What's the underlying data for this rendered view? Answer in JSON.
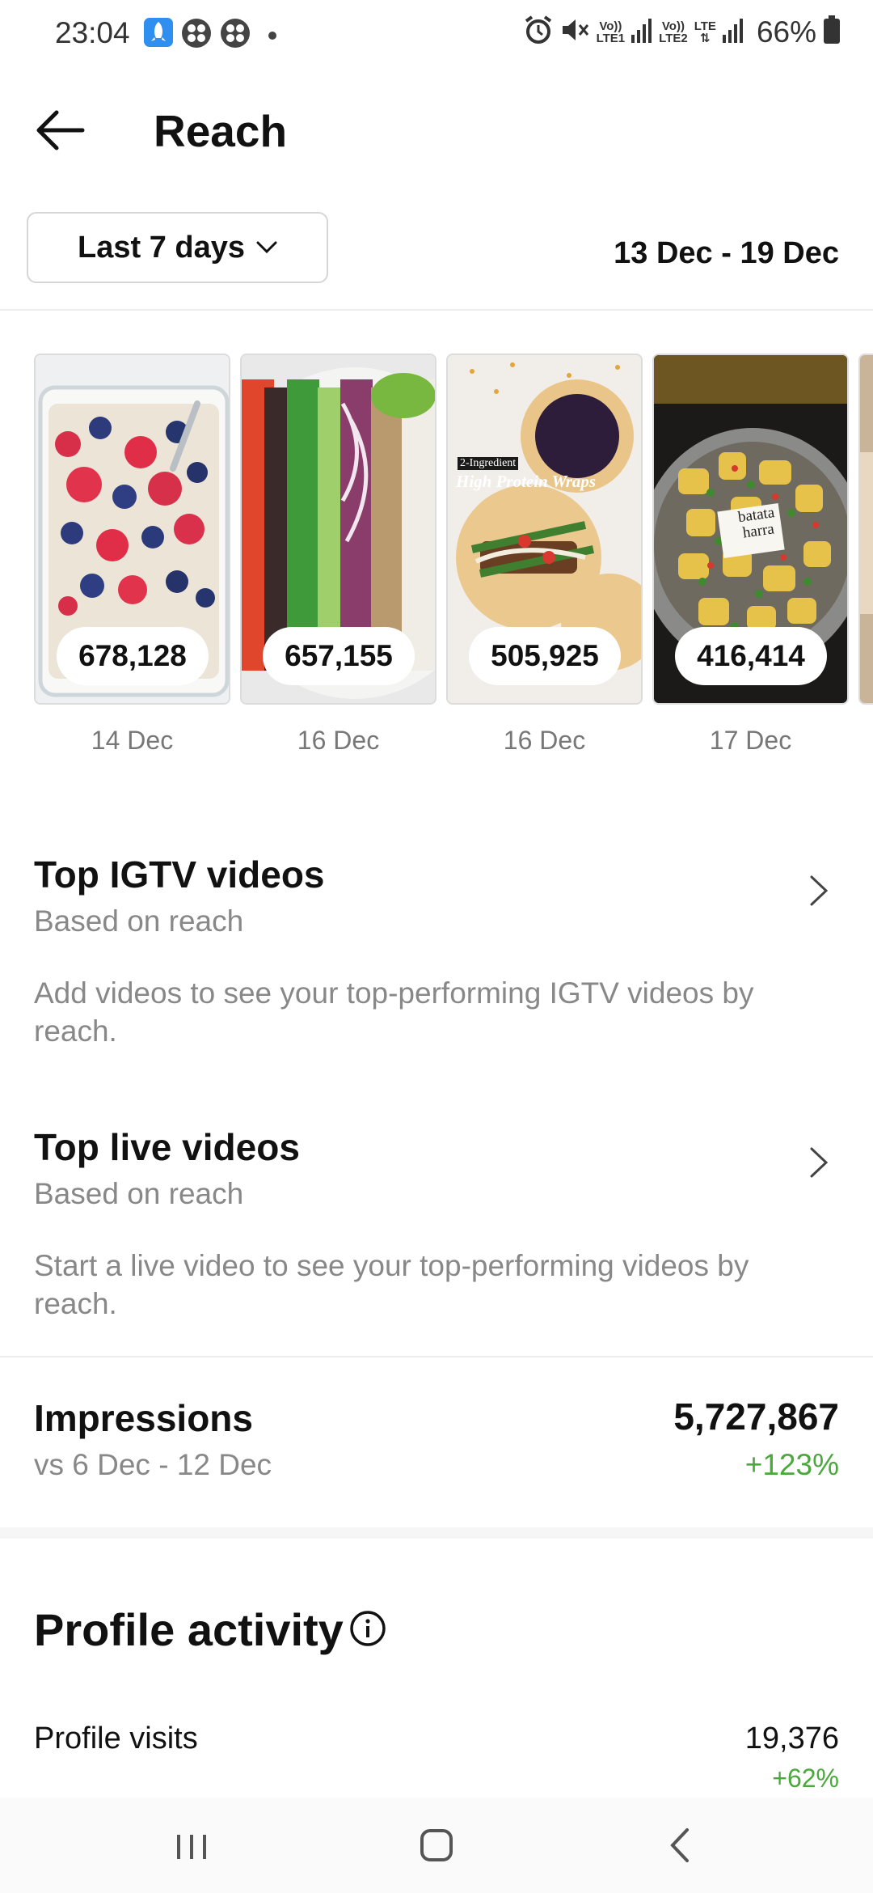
{
  "status_bar": {
    "time": "23:04",
    "battery": "66%",
    "net1_top": "Vo))",
    "net1_bottom": "LTE1",
    "net2_top": "Vo))",
    "net2_bottom": "LTE2",
    "net3_top": "LTE",
    "icons": [
      "rocket-app-icon",
      "app-grid-icon",
      "app-grid-icon",
      "dot-icon",
      "alarm-icon",
      "mute-icon",
      "signal-icon",
      "signal-icon",
      "battery-icon"
    ]
  },
  "header": {
    "title": "Reach",
    "back_icon": "arrow-left-icon"
  },
  "filter": {
    "range_label": "Last 7 days",
    "date_range": "13 Dec - 19 Dec"
  },
  "top_posts": [
    {
      "reach": "678,128",
      "date": "14 Dec",
      "subject": "berry oats"
    },
    {
      "reach": "657,155",
      "date": "16 Dec",
      "subject": "salad"
    },
    {
      "reach": "505,925",
      "date": "16 Dec",
      "subject": "wraps",
      "overlay_small": "2-Ingredient",
      "overlay_big": "High Protein Wraps"
    },
    {
      "reach": "416,414",
      "date": "17 Dec",
      "subject": "potatoes",
      "overlay_label_1": "batata",
      "overlay_label_2": "harra"
    }
  ],
  "igtv": {
    "title": "Top IGTV videos",
    "subtitle": "Based on reach",
    "body": "Add videos to see your top-performing IGTV videos by reach."
  },
  "live": {
    "title": "Top live videos",
    "subtitle": "Based on reach",
    "body": "Start a live video to see your top-performing videos by reach."
  },
  "impressions": {
    "label": "Impressions",
    "value": "5,727,867",
    "comparison": "vs 6 Dec - 12 Dec",
    "change": "+123%"
  },
  "profile_activity": {
    "title": "Profile activity",
    "rows": [
      {
        "label": "Profile visits",
        "value": "19,376",
        "change": "+62%"
      }
    ]
  },
  "colors": {
    "positive": "#4aa83c",
    "muted": "#888888"
  }
}
